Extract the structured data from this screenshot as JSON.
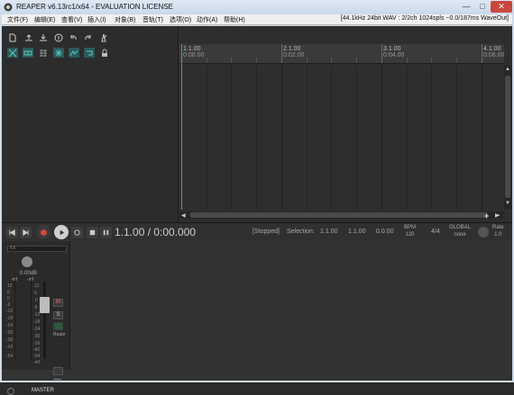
{
  "window": {
    "title": "REAPER v6.13rc1/x64 - EVALUATION LICENSE",
    "min": "—",
    "max": "□",
    "close": "✕"
  },
  "menu": {
    "items": [
      "文件(F)",
      "编辑(E)",
      "查看(V)",
      "插入(I)",
      "对象(B)",
      "音轨(T)",
      "选项(O)",
      "动作(A)",
      "帮助(H)"
    ],
    "status": "[44.1kHz 24bit WAV : 2/2ch 1024spls ~0.0/187ms WaveOut]"
  },
  "toolbar": {
    "icons": [
      "new-project-icon",
      "open-project-icon",
      "save-project-icon",
      "project-settings-icon",
      "undo-icon",
      "redo-icon",
      "metronome-icon",
      "ripple-edit-icon",
      "item-grouping-icon",
      "snap-icon",
      "grid-icon",
      "envelope-lock-icon",
      "auto-crossfade-icon",
      "loop-points-icon",
      "lock-icon"
    ]
  },
  "ruler": {
    "marks": [
      {
        "bar": "1.1.00",
        "time": "0:00.00"
      },
      {
        "bar": "2.1.00",
        "time": "0:02.00"
      },
      {
        "bar": "3.1.00",
        "time": "0:04.00"
      },
      {
        "bar": "4.1.00",
        "time": "0:06.00"
      }
    ]
  },
  "transport": {
    "position": "1.1.00 / 0:00.000",
    "status": "[Stopped]",
    "selection_label": "Selection:",
    "sel_start": "1.1.00",
    "sel_end": "1.1.00",
    "sel_length": "0.0.00",
    "bpm_label": "BPM",
    "bpm": "120",
    "time_sig": "4/4",
    "global_label": "GLOBAL",
    "global_value": "none",
    "rate_label": "Rate",
    "rate": "1.0"
  },
  "master": {
    "label": "MASTER",
    "fx_label": "FX",
    "volume": "0.00dB",
    "peak_l": "-inf",
    "peak_r": "-inf",
    "route_label": "Route",
    "trim_label": "trim",
    "meter_scale": [
      "12",
      "6",
      "0",
      "-6",
      "-12",
      "-18",
      "-24",
      "-30",
      "-36",
      "-42",
      "-54"
    ],
    "fader_scale": [
      "12",
      "6",
      "0",
      "-6",
      "-12",
      "-18",
      "-24",
      "-30",
      "-36",
      "-42",
      "-54",
      "-inf"
    ],
    "mute": "M",
    "solo": "S"
  }
}
